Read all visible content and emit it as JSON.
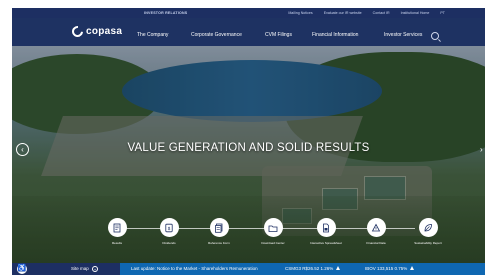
{
  "topbar": {
    "section": "INVESTOR RELATIONS",
    "links": [
      "Mailing Notices",
      "Evaluate our IR website",
      "Contact IR",
      "Institutional Home",
      "PT"
    ]
  },
  "brand": {
    "name": "copasa"
  },
  "nav": {
    "items": [
      "The Company",
      "Corporate Governance",
      "CVM Filings",
      "Financial Information",
      "Investor Services"
    ]
  },
  "hero": {
    "headline": "VALUE GENERATION AND SOLID RESULTS",
    "prev_arrow": "‹",
    "next_arrow": "›"
  },
  "shortcuts": [
    {
      "label": "Results",
      "icon": "results-icon"
    },
    {
      "label": "Dividends",
      "icon": "dividends-icon"
    },
    {
      "label": "Reference Form",
      "icon": "reference-form-icon"
    },
    {
      "label": "Download Center",
      "icon": "folder-icon"
    },
    {
      "label": "Interactive Spreadsheet",
      "icon": "spreadsheet-icon"
    },
    {
      "label": "Financial Data",
      "icon": "financial-data-icon"
    },
    {
      "label": "Sustainability Report",
      "icon": "leaf-icon"
    }
  ],
  "footer": {
    "sitemap": "Site map",
    "sitemap_plus": "+",
    "last_update": "Last update: Notice to the Market - Shareholders Remuneration",
    "csmg": "CSMG3 R$26.52 1.26%",
    "bov": "IBOV 133,515 0.75%"
  }
}
